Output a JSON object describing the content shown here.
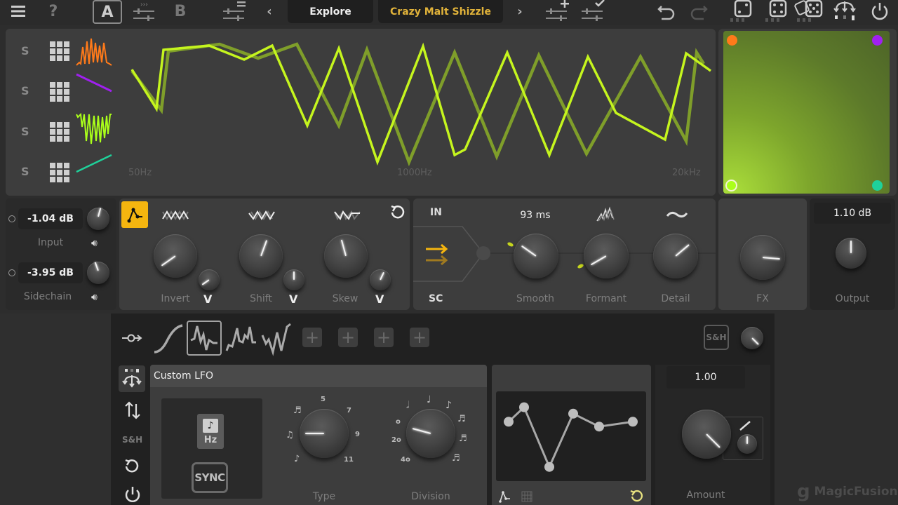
{
  "topbar": {
    "menu_icon": "hamburger-menu-icon",
    "help_icon": "question-mark-icon",
    "preset_a_label": "A",
    "preset_b_label": "B",
    "nav_prev": "‹",
    "nav_next": "›",
    "explore_label": "Explore",
    "preset_name": "Crazy Malt Shizzle",
    "undo_icon": "undo-icon",
    "redo_icon": "redo-icon",
    "power_icon": "power-icon"
  },
  "layers": {
    "solo_labels": [
      "S",
      "S",
      "S",
      "S"
    ],
    "colors": [
      "#ff7a1a",
      "#a020f0",
      "#aaff1a",
      "#1fd19a"
    ]
  },
  "spectrum": {
    "freq_labels": [
      "50Hz",
      "1000Hz",
      "20kHz"
    ],
    "line_color": "#c5f51e",
    "shadow_line_color": "#7f9e2a"
  },
  "xy_pad": {
    "corner_colors": [
      "#ff7a1a",
      "#a020f0",
      "#aaff1a",
      "#1fd19a"
    ]
  },
  "io": {
    "input_value": "-1.04 dB",
    "input_label": "Input",
    "sidechain_value": "-3.95 dB",
    "sidechain_label": "Sidechain"
  },
  "shape": {
    "accent_color": "#f5b50f",
    "knobs": [
      {
        "label": "Invert",
        "value": 0.15
      },
      {
        "label": "Shift",
        "value": 0.55
      },
      {
        "label": "Skew",
        "value": 0.45
      }
    ],
    "dropdown_glyph": "V"
  },
  "routing": {
    "in_label": "IN",
    "sc_label": "SC"
  },
  "smooth": {
    "value": "93 ms",
    "label": "Smooth"
  },
  "formant": {
    "label": "Formant"
  },
  "detail": {
    "label": "Detail"
  },
  "fx": {
    "label": "FX"
  },
  "output": {
    "value": "1.10 dB",
    "label": "Output"
  },
  "mod": {
    "sh_label": "S&H",
    "lfo_title": "Custom LFO",
    "hz_label": "Hz",
    "sync_label": "SYNC",
    "sidebar_sh": "S&H",
    "type_label": "Type",
    "type_scale": [
      "5",
      "7",
      "9",
      "11"
    ],
    "division_label": "Division",
    "division_scale_left": [
      "o",
      "2o",
      "4o"
    ],
    "amount_value": "1.00",
    "amount_label": "Amount",
    "lfo_points": [
      0.45,
      0.9,
      -0.95,
      0.7,
      0.3,
      0.45
    ]
  },
  "watermark": "MagicFusion"
}
